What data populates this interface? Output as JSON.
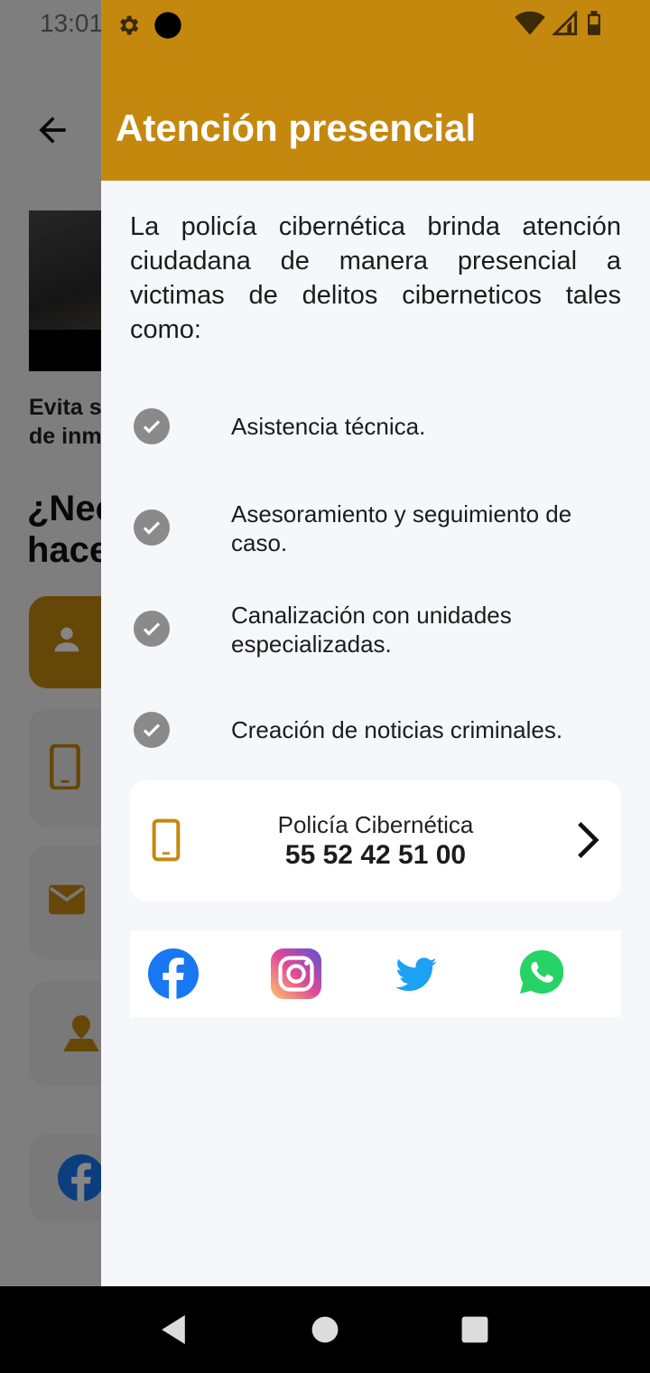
{
  "status_bar": {
    "time": "13:01"
  },
  "background": {
    "article_title": "Evita s\nde inm",
    "heading": "¿Nec\nhace"
  },
  "drawer": {
    "title": "Atención presencial",
    "intro": "La policía cibernética brinda atención ciudadana de manera presencial a victimas de delitos ciberneticos tales como:",
    "services": [
      "Asistencia técnica.",
      "Asesoramiento y seguimiento de caso.",
      "Canalización con unidades especializadas.",
      "Creación de noticias criminales."
    ],
    "contact": {
      "name": "Policía Cibernética",
      "number": "55 52 42 51 00"
    },
    "social": [
      "facebook-icon",
      "instagram-icon",
      "twitter-icon",
      "whatsapp-icon"
    ]
  },
  "colors": {
    "accent": "#c5880f",
    "check": "#8a8a8a",
    "twitter": "#1da1f2",
    "whatsapp": "#25d366",
    "facebook": "#1877f2"
  }
}
